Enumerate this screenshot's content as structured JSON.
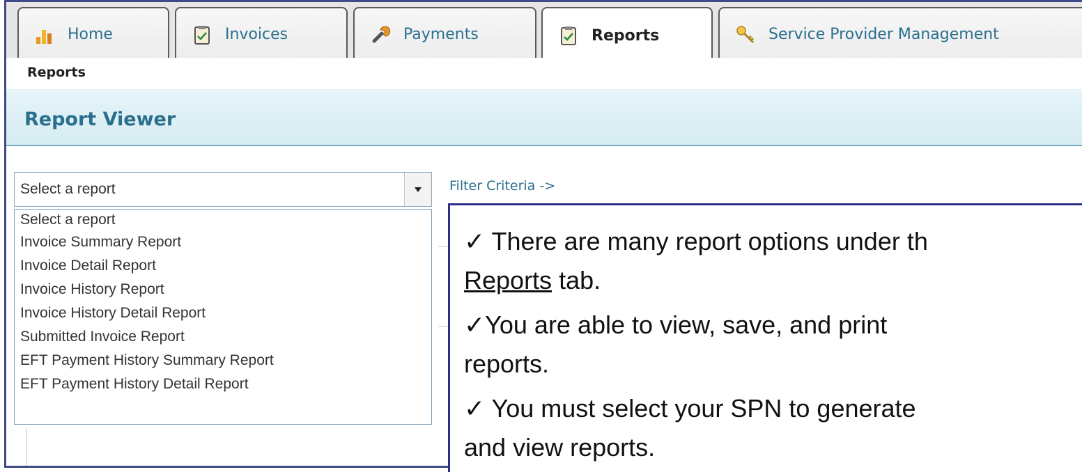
{
  "tabs": [
    {
      "label": "Home",
      "icon": "bar-chart-icon",
      "active": false
    },
    {
      "label": "Invoices",
      "icon": "clipboard-icon",
      "active": false
    },
    {
      "label": "Payments",
      "icon": "wrench-icon",
      "active": false
    },
    {
      "label": "Reports",
      "icon": "clipboard-icon",
      "active": true
    },
    {
      "label": "Service Provider Management",
      "icon": "key-icon",
      "active": false
    }
  ],
  "subnav": {
    "label": "Reports"
  },
  "header": {
    "title": "Report Viewer"
  },
  "select": {
    "value": "Select a report",
    "options": [
      "Select a report",
      "Invoice Summary Report",
      "Invoice Detail Report",
      "Invoice History Report",
      "Invoice History Detail Report",
      "Submitted Invoice Report",
      "EFT Payment History Summary Report",
      "EFT Payment History Detail Report"
    ]
  },
  "filter_link": "Filter Criteria ->",
  "callout": {
    "line1_check": "✓",
    "line1": " There are many report options under th",
    "line2_underlined": "Reports",
    "line2_rest": " tab.",
    "line3_check": "✓",
    "line3": "You are able to view, save, and print",
    "line4": "reports.",
    "line5_check": "✓",
    "line5": " You must select your SPN to generate",
    "line6": "and view reports."
  },
  "colors": {
    "frame": "#3f4a86",
    "accent": "#2a6f8e",
    "callout_border": "#2e2f86"
  }
}
